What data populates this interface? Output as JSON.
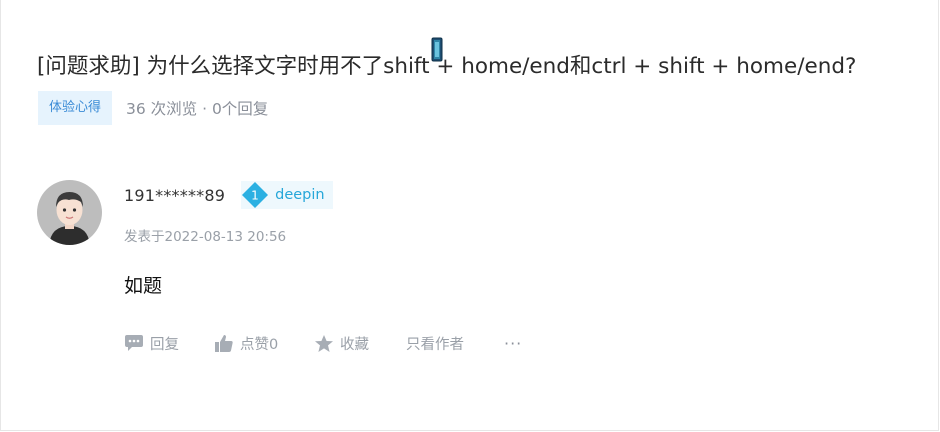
{
  "post": {
    "title": "[问题求助] 为什么选择文字时用不了shift + home/end和ctrl + shift + home/end?",
    "tag": "体验心得",
    "stats": "36 次浏览 · 0个回复"
  },
  "reply": {
    "author": "191******89",
    "badge_level": "1",
    "badge_label": "deepin",
    "time": "发表于2022-08-13 20:56",
    "content": "如题"
  },
  "actions": {
    "reply": "回复",
    "like": "点赞0",
    "favorite": "收藏",
    "only_author": "只看作者",
    "more": "···"
  },
  "icons": {
    "reply": "comment-icon",
    "like": "thumbs-up-icon",
    "favorite": "star-icon",
    "badge": "level-diamond-icon",
    "cursor": "text-cursor-icon"
  },
  "colors": {
    "tag_bg": "#e6f3fd",
    "tag_text": "#3a8bd6",
    "badge": "#26a7d9",
    "muted": "#9aa0a8"
  }
}
